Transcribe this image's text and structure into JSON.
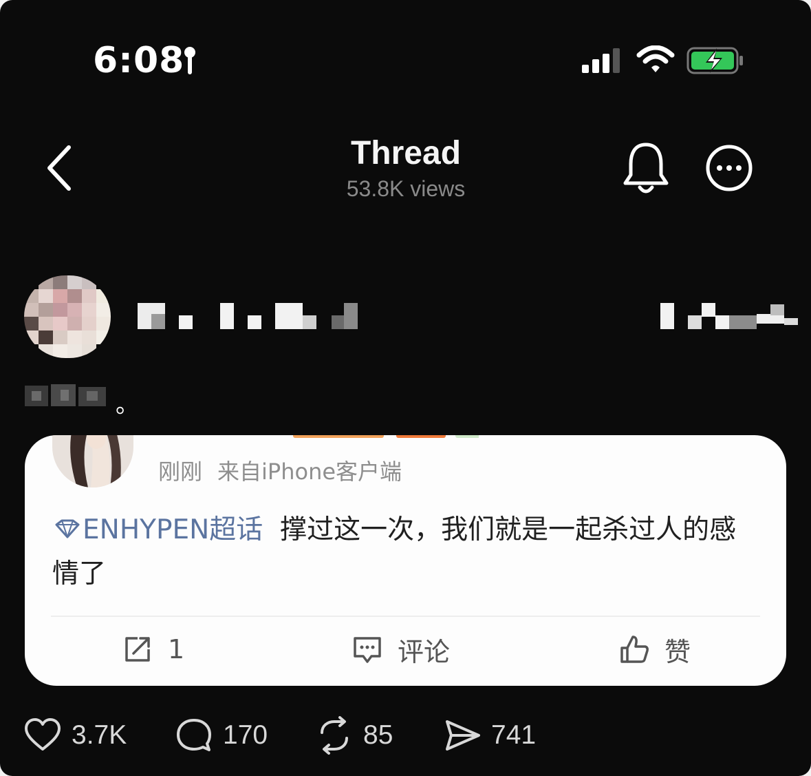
{
  "status_bar": {
    "time": "6:08",
    "icons": [
      "location-icon",
      "signal-icon",
      "wifi-icon",
      "battery-charging-icon"
    ],
    "battery_color": "#34c759"
  },
  "header": {
    "title": "Thread",
    "views": "53.8K views",
    "icons": [
      "back-icon",
      "bell-icon",
      "more-icon"
    ]
  },
  "post": {
    "text_suffix": "。"
  },
  "embedded_card": {
    "meta_time": "刚刚",
    "meta_source": "来自iPhone客户端",
    "topic": "ENHYPEN超话",
    "body": "撑过这一次，我们就是一起杀过人的感情了",
    "actions": {
      "share_count": "1",
      "comment_label": "评论",
      "like_label": "赞"
    },
    "topic_color": "#5b74a0"
  },
  "footer": {
    "likes": "3.7K",
    "replies": "170",
    "reposts": "85",
    "shares": "741"
  }
}
